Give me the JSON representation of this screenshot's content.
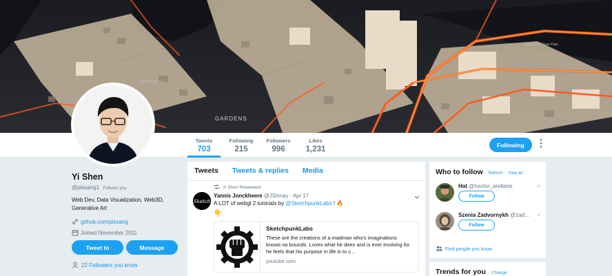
{
  "nav": {
    "stats": [
      {
        "label": "Tweets",
        "value": "703"
      },
      {
        "label": "Following",
        "value": "215"
      },
      {
        "label": "Followers",
        "value": "996"
      },
      {
        "label": "Likes",
        "value": "1,231"
      }
    ],
    "following_button": "Following"
  },
  "banner": {
    "labels": [
      "GARDENS",
      "Gansevoort Plaza",
      "Stuyvesant Cove Park"
    ]
  },
  "profile": {
    "name": "Yi Shen",
    "handle": "@pissang1",
    "follows_you": "Follows you",
    "bio": "Web Dev, Data Visualization, Web3D, Generative Art",
    "link": "github.com/pissang",
    "joined": "Joined November 2011",
    "tweet_to_button": "Tweet to",
    "message_button": "Message",
    "followers_you_know": "22 Followers you know"
  },
  "timeline": {
    "tabs": [
      "Tweets",
      "Tweets & replies",
      "Media"
    ],
    "tweet": {
      "retweeted_by": "Yi Shen Retweeted",
      "author_name": "Yannis Jonckheere",
      "author_handle": "@JSinnay",
      "date": "Apr 17",
      "text_prefix": "A LOT of webgl 2 tutorials by ",
      "mention": "@SketchpunkLabs",
      "text_suffix": " ! 🔥",
      "hand_emoji": "👇",
      "card": {
        "title": "SketchpunkLabs",
        "description": "These are the creations of a madman who's imaginations knows no bounds. Loves what he does and is ever evolving for he feels that his purpose in life is to c...",
        "url": "youtube.com"
      }
    }
  },
  "who_to_follow": {
    "title": "Who to follow",
    "refresh": "Refresh",
    "view_all": "View all",
    "separator": "·",
    "users": [
      {
        "name": "Hat",
        "handle": "@hector_arellano",
        "button": "Follow"
      },
      {
        "name": "Szenia Zadvornykh",
        "handle": "@zad...",
        "button": "Follow"
      }
    ],
    "find_people": "Find people you know"
  },
  "trends": {
    "title": "Trends for you",
    "change": "Change"
  },
  "colors": {
    "accent": "#1da1f2",
    "link": "#1b95e0",
    "muted": "#657786",
    "background": "#e6ecf0",
    "heat": "#ff5a1f"
  }
}
